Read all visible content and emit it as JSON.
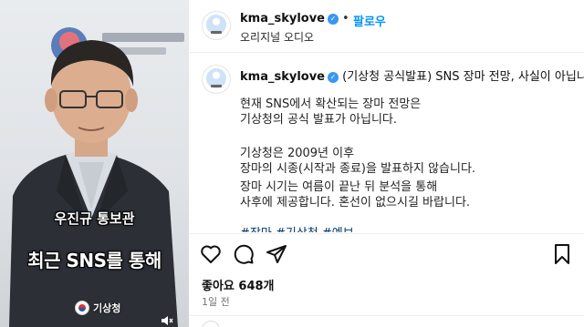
{
  "video": {
    "name_caption": "우진규 통보관",
    "subtitle": "최근 SNS를 통해",
    "watermark": "기상청",
    "mute_icon": "mute-icon"
  },
  "header": {
    "username": "kma_skylove",
    "separator": "•",
    "follow_label": "팔로우",
    "audio": "오리지널 오디오"
  },
  "caption": {
    "username": "kma_skylove",
    "headline": "(기상청 공식발표) SNS 장마 전망, 사실이 아닙니다!",
    "para1_line1": "현재 SNS에서 확산되는 장마 전망은",
    "para1_line2": "기상청의 공식 발표가 아닙니다.",
    "para2_line1": "기상청은 2009년 이후",
    "para2_line2": "장마의 시종(시작과 종료)을 발표하지 않습니다.",
    "para3_line1": "장마 시기는 여름이 끝난 뒤 분석을 통해",
    "para3_line2": "사후에 제공합니다. 혼선이 없으시길 바랍니다.",
    "tags": "#장마 #기상청 #예보"
  },
  "actions": {
    "icons": [
      "heart-icon",
      "comment-icon",
      "share-icon",
      "bookmark-icon"
    ]
  },
  "stats": {
    "likes": "좋아요 648개",
    "time": "1일 전"
  },
  "colors": {
    "link_blue": "#0095f6",
    "verified_blue": "#3897f0",
    "hashtag": "#00376b"
  }
}
